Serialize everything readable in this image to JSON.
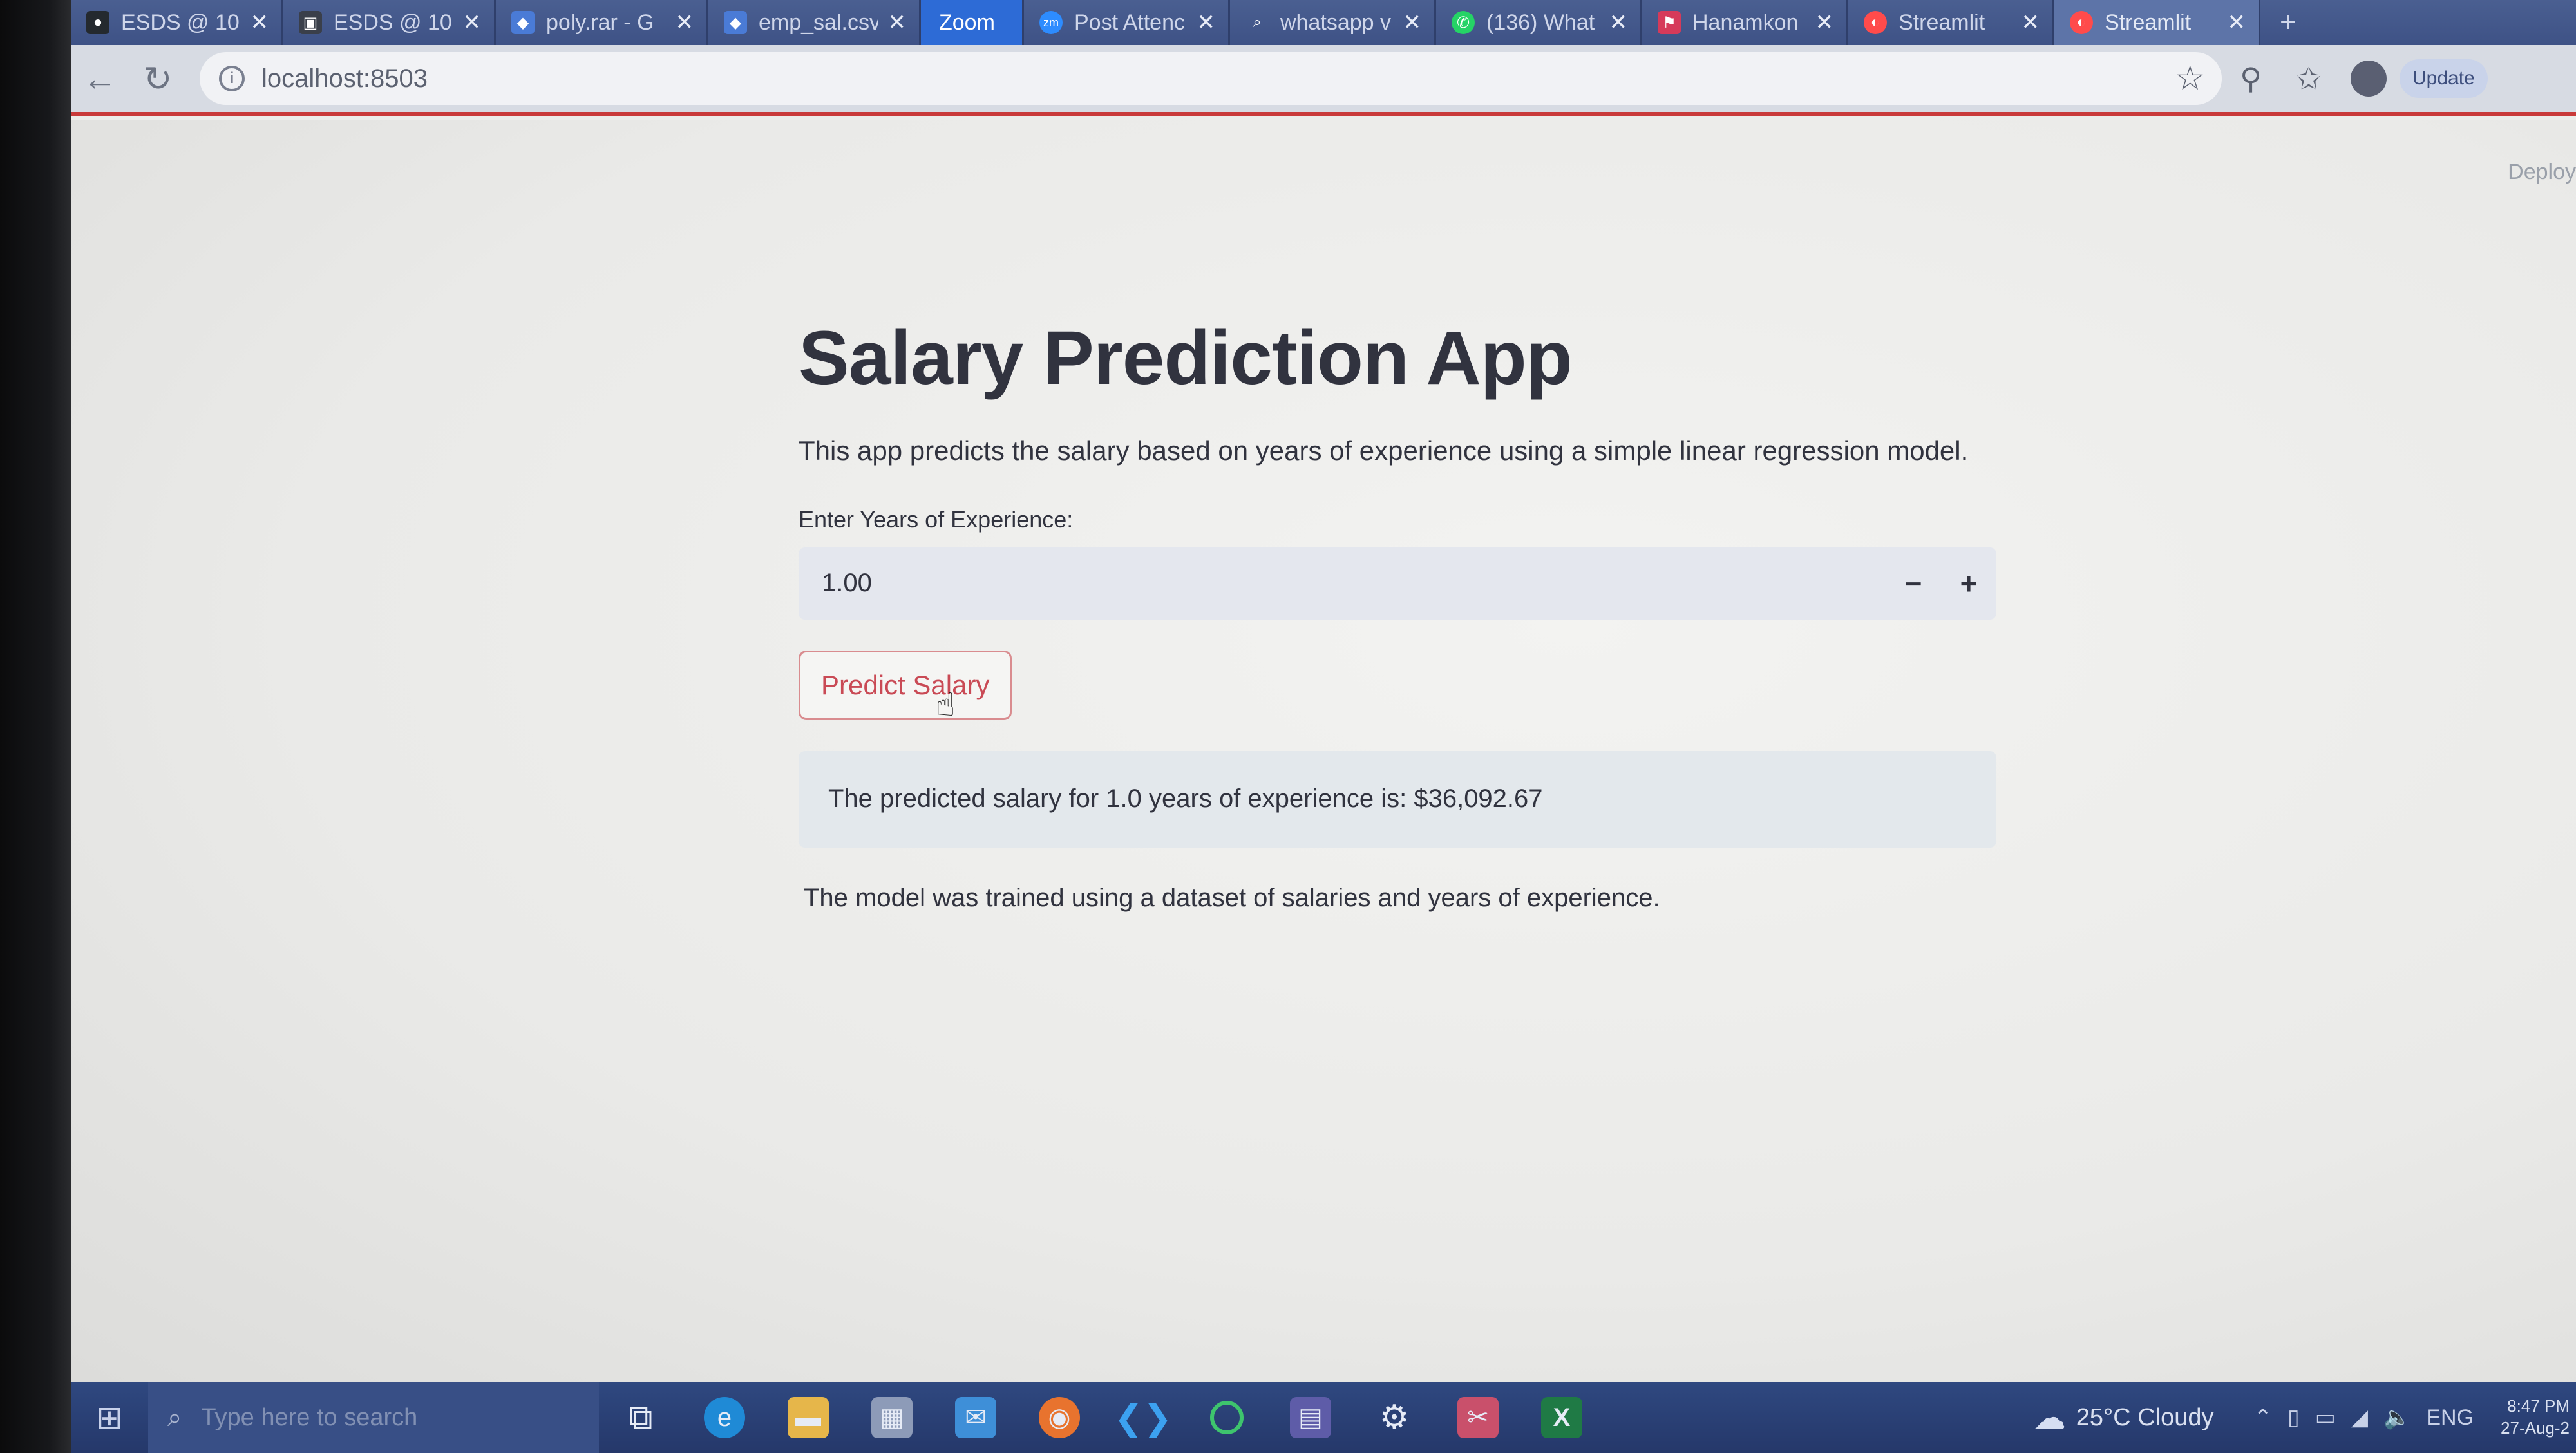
{
  "browser": {
    "tabs": [
      {
        "title": "ESDS @ 10",
        "favicon": "github-icon",
        "color": "#24292e",
        "glyph": "●"
      },
      {
        "title": "ESDS @ 10",
        "favicon": "classroom-icon",
        "color": "#3a3f4a",
        "glyph": "▣"
      },
      {
        "title": "poly.rar - G",
        "favicon": "drive-icon",
        "color": "#4a7bd6",
        "glyph": "◆"
      },
      {
        "title": "emp_sal.csv",
        "favicon": "drive-icon",
        "color": "#4a7bd6",
        "glyph": "◆"
      },
      {
        "title": "Zoom",
        "favicon": "zoom-label",
        "color": "#2d6bd6",
        "glyph": ""
      },
      {
        "title": "Post Attenc",
        "favicon": "zoom-icon",
        "color": "#2d8cff",
        "glyph": "zm"
      },
      {
        "title": "whatsapp v",
        "favicon": "search-icon",
        "color": "transparent",
        "glyph": "🔍"
      },
      {
        "title": "(136) What",
        "favicon": "whatsapp-icon",
        "color": "#25d366",
        "glyph": "✆"
      },
      {
        "title": "Hanamkon",
        "favicon": "bookmark-icon",
        "color": "#d63a5a",
        "glyph": "⚑"
      },
      {
        "title": "Streamlit",
        "favicon": "streamlit-icon",
        "color": "#ff4b4b",
        "glyph": "◐"
      },
      {
        "title": "Streamlit",
        "favicon": "streamlit-icon",
        "color": "#ff4b4b",
        "glyph": "◐"
      }
    ],
    "close_glyph": "✕",
    "new_tab_glyph": "+",
    "url": "localhost:8503",
    "update_label": "Update"
  },
  "page": {
    "deploy_label": "Deploy",
    "title": "Salary Prediction App",
    "description": "This app predicts the salary based on years of experience using a simple linear regression model.",
    "input_label": "Enter Years of Experience:",
    "input_value": "1.00",
    "minus_label": "−",
    "plus_label": "+",
    "button_label": "Predict Salary",
    "result_text": "The predicted salary for 1.0 years of experience is: $36,092.67",
    "footer_text": "The model was trained using a dataset of salaries and years of experience."
  },
  "taskbar": {
    "search_placeholder": "Type here to search",
    "weather": "25°C  Cloudy",
    "language": "ENG",
    "time": "8:47 PM",
    "date": "27-Aug-2"
  }
}
